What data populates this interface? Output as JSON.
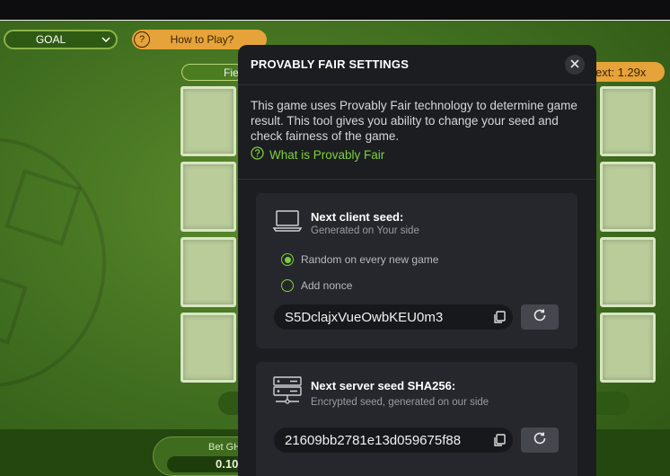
{
  "game": {
    "selector_value": "GOAL",
    "how_to_play": "How to Play?",
    "field_label": "Fie",
    "next_multiplier": "ext: 1.29x",
    "bet_label": "Bet GH",
    "bet_value": "0.10"
  },
  "modal": {
    "title": "PROVABLY FAIR SETTINGS",
    "description": "This game uses Provably Fair technology to determine game result. This tool gives you ability to change your seed and check fairness of the game.",
    "what_is_link": "What is Provably Fair",
    "client": {
      "title": "Next client seed:",
      "subtitle": "Generated on Your side",
      "options": [
        "Random on every new game",
        "Add nonce"
      ],
      "selected_option": "Random on every new game",
      "seed": "S5DclajxVueOwbKEU0m3"
    },
    "server": {
      "title": "Next server seed SHA256:",
      "subtitle": "Encrypted seed, generated on our side",
      "seed": "21609bb2781e13d059675f88"
    }
  },
  "icons": {
    "accent_color": "#7ed03a"
  }
}
